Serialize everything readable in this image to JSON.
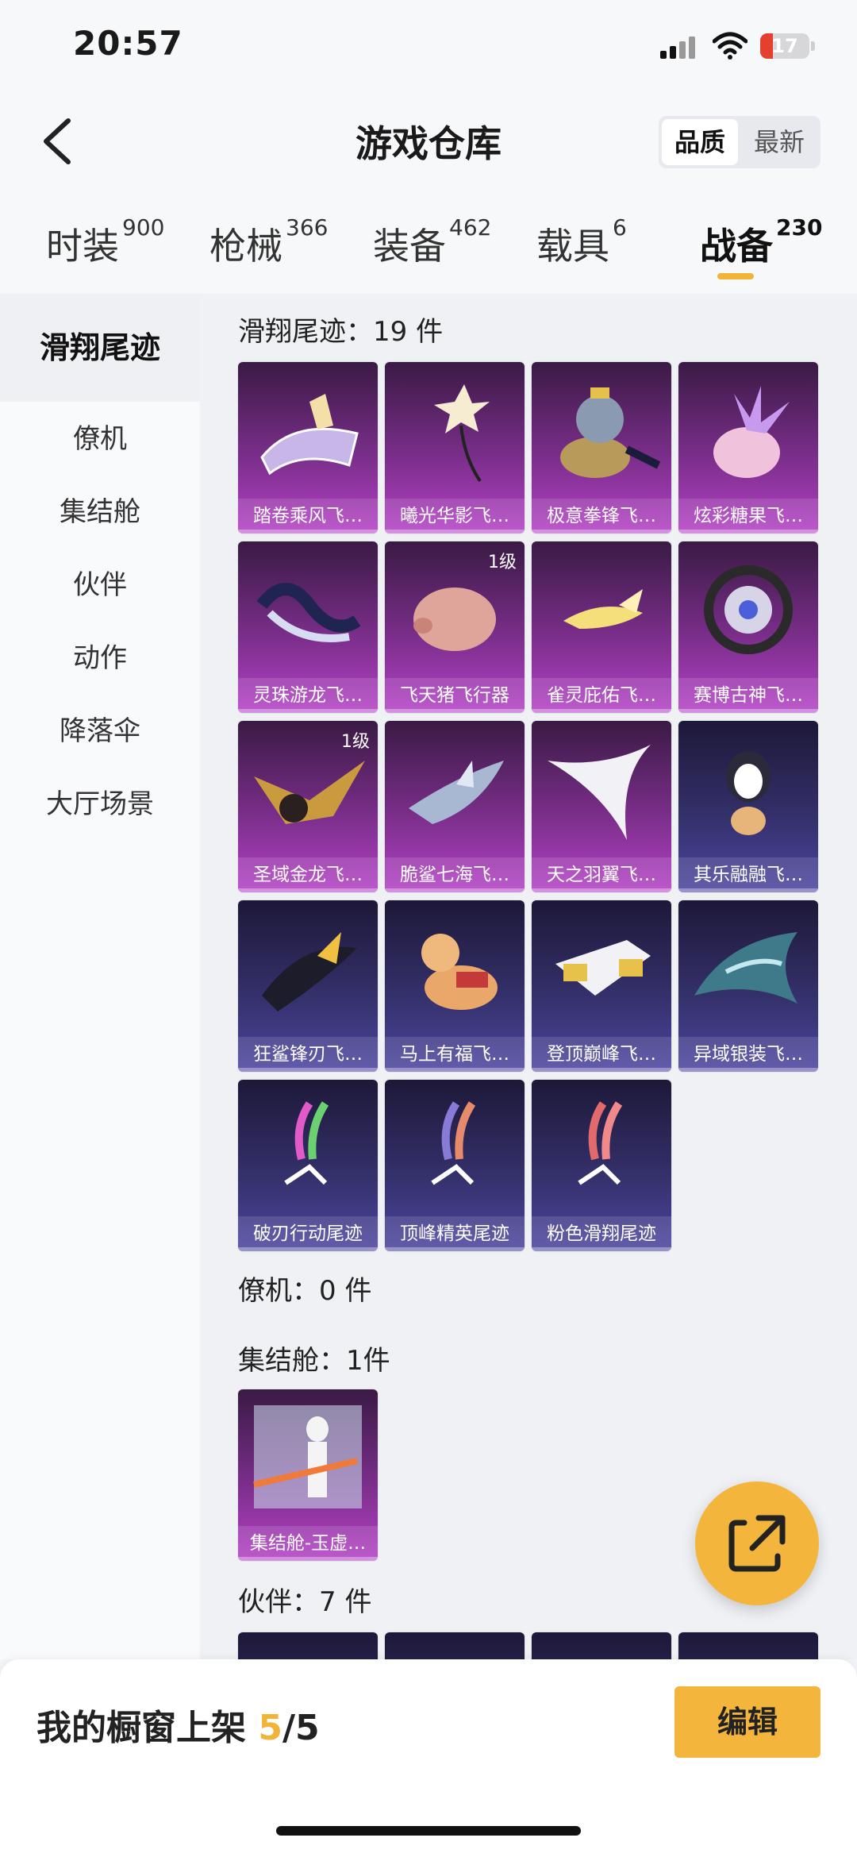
{
  "status_bar": {
    "time": "20:57",
    "battery": "17"
  },
  "header": {
    "title": "游戏仓库",
    "sort_options": [
      "品质",
      "最新"
    ],
    "active_sort": "品质"
  },
  "tabs": [
    {
      "label": "时装",
      "count": "900"
    },
    {
      "label": "枪械",
      "count": "366"
    },
    {
      "label": "装备",
      "count": "462"
    },
    {
      "label": "载具",
      "count": "6"
    },
    {
      "label": "战备",
      "count": "230"
    }
  ],
  "active_tab": "战备",
  "sidebar": [
    "滑翔尾迹",
    "僚机",
    "集结舱",
    "伙伴",
    "动作",
    "降落伞",
    "大厅场景"
  ],
  "sections": {
    "glide": {
      "title": "滑翔尾迹：19 件",
      "items": [
        {
          "name": "踏卷乘风飞…",
          "level": ""
        },
        {
          "name": "曦光华影飞…",
          "level": ""
        },
        {
          "name": "极意拳锋飞…",
          "level": ""
        },
        {
          "name": "炫彩糖果飞…",
          "level": ""
        },
        {
          "name": "灵珠游龙飞…",
          "level": ""
        },
        {
          "name": "飞天猪飞行器",
          "level": "1级"
        },
        {
          "name": "雀灵庇佑飞…",
          "level": ""
        },
        {
          "name": "赛博古神飞…",
          "level": ""
        },
        {
          "name": "圣域金龙飞…",
          "level": "1级"
        },
        {
          "name": "脆鲨七海飞…",
          "level": ""
        },
        {
          "name": "天之羽翼飞…",
          "level": ""
        },
        {
          "name": "其乐融融飞…",
          "level": ""
        },
        {
          "name": "狂鲨锋刃飞…",
          "level": ""
        },
        {
          "name": "马上有福飞…",
          "level": ""
        },
        {
          "name": "登顶巅峰飞…",
          "level": ""
        },
        {
          "name": "异域银装飞…",
          "level": ""
        },
        {
          "name": "破刃行动尾迹",
          "level": ""
        },
        {
          "name": "顶峰精英尾迹",
          "level": ""
        },
        {
          "name": "粉色滑翔尾迹",
          "level": ""
        }
      ]
    },
    "wingman": {
      "title": "僚机：0 件"
    },
    "capsule": {
      "title": "集结舱：1件",
      "items": [
        {
          "name": "集结舱-玉虚…",
          "level": ""
        }
      ]
    },
    "partner": {
      "title": "伙伴：7 件"
    }
  },
  "bottom": {
    "label": "我的橱窗上架 ",
    "count": "5",
    "total": "/5",
    "edit": "编辑"
  },
  "colors": {
    "accent": "#f3b53b",
    "purple_card": "#8a33a0",
    "blue_card": "#3a3578"
  }
}
